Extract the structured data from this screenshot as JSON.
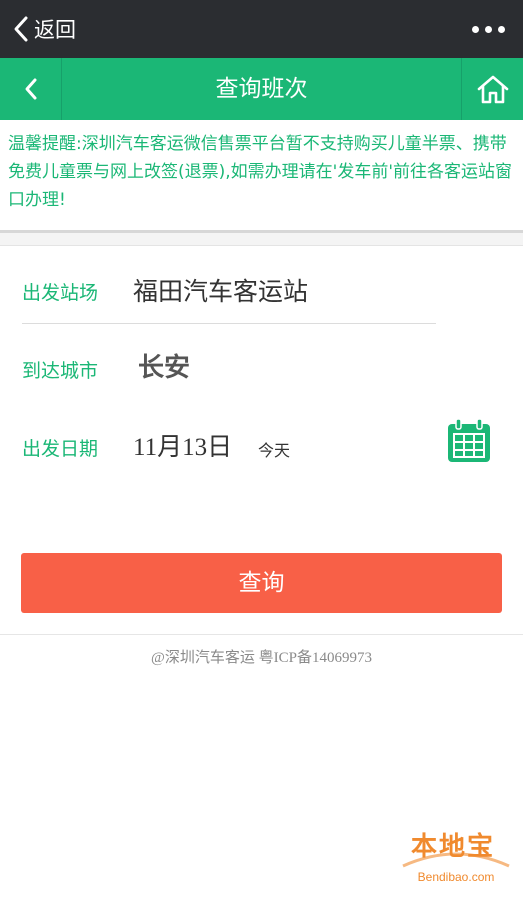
{
  "wechat_bar": {
    "back_label": "返回"
  },
  "header": {
    "title": "查询班次"
  },
  "notice": {
    "text": "温馨提醒:深圳汽车客运微信售票平台暂不支持购买儿童半票、携带免费儿童票与网上改签(退票),如需办理请在'发车前'前往各客运站窗口办理!"
  },
  "form": {
    "departure_station": {
      "label": "出发站场",
      "value": "福田汽车客运站"
    },
    "arrival_city": {
      "label": "到达城市",
      "value": "长安"
    },
    "departure_date": {
      "label": "出发日期",
      "value": "11月13日",
      "note": "今天"
    }
  },
  "query_button": {
    "label": "查询"
  },
  "footer": {
    "text": "@深圳汽车客运 粤ICP备14069973"
  },
  "watermark": {
    "text": "本地宝",
    "sub": "Bendibao.com"
  },
  "colors": {
    "brand_green": "#1bb776",
    "button_red": "#f86047",
    "wechat_bar": "#2b2d31"
  },
  "icons": {
    "back": "chevron-left-icon",
    "more": "more-dots-icon",
    "home": "home-icon",
    "calendar": "calendar-icon"
  }
}
